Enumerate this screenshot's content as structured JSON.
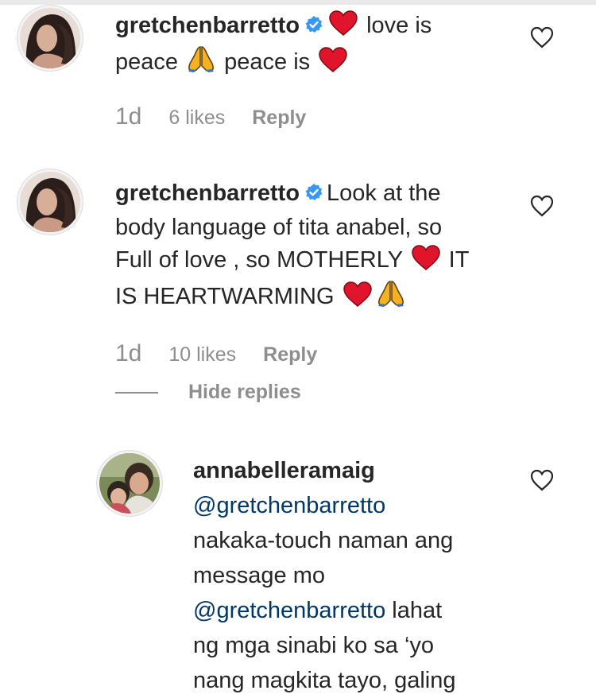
{
  "comments": [
    {
      "username": "gretchenbarretto",
      "verified": true,
      "text_parts": [
        "love is",
        "peace",
        "peace is"
      ],
      "time": "1d",
      "likes": "6 likes",
      "reply_label": "Reply"
    },
    {
      "username": "gretchenbarretto",
      "verified": true,
      "text_line1": "Look at the",
      "text_line2": "body language of tita anabel, so",
      "text_line3a": "Full of love , so MOTHERLY",
      "text_line3b": "IT",
      "text_line4": "IS HEARTWARMING",
      "time": "1d",
      "likes": "10 likes",
      "reply_label": "Reply"
    }
  ],
  "hide_replies_label": "Hide replies",
  "reply": {
    "username": "annabelleramaig",
    "mention1": "@gretchenbarretto",
    "line2": "nakaka-touch naman ang",
    "line3": "message mo",
    "mention2": "@gretchenbarretto",
    "line4_rest": " lahat",
    "line5": "ng mga sinabi ko sa ‘yo",
    "line6": "nang magkita tayo, galing"
  },
  "icons": {
    "verified": "verified-badge-icon",
    "heart_emoji": "red-heart-emoji",
    "pray_emoji": "folded-hands-emoji",
    "like": "heart-outline-icon"
  },
  "colors": {
    "text": "#262626",
    "secondary": "#8e8e8e",
    "mention": "#00376b",
    "verified": "#3897f0",
    "heart": "#e0152b"
  }
}
